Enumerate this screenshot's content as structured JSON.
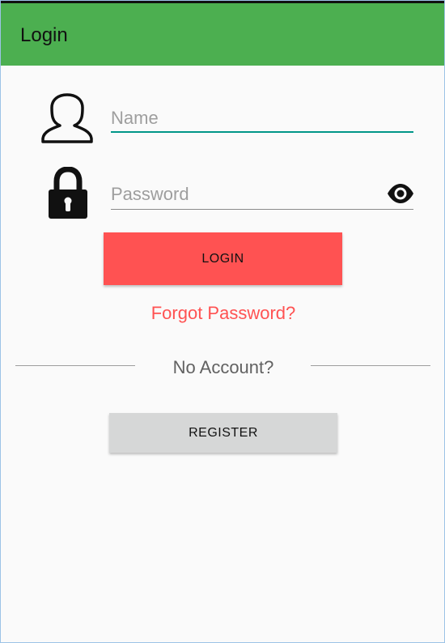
{
  "appbar": {
    "title": "Login",
    "color": "#4caf50"
  },
  "form": {
    "name": {
      "placeholder": "Name",
      "value": "",
      "icon": "user-icon",
      "focused_underline_color": "#009688"
    },
    "password": {
      "placeholder": "Password",
      "value": "",
      "icon": "lock-icon",
      "toggle_icon": "eye-icon"
    }
  },
  "actions": {
    "login_label": "LOGIN",
    "login_color": "#ff5252",
    "forgot_label": "Forgot Password?",
    "no_account_label": "No Account?",
    "register_label": "REGISTER",
    "register_color": "#d6d7d7"
  }
}
